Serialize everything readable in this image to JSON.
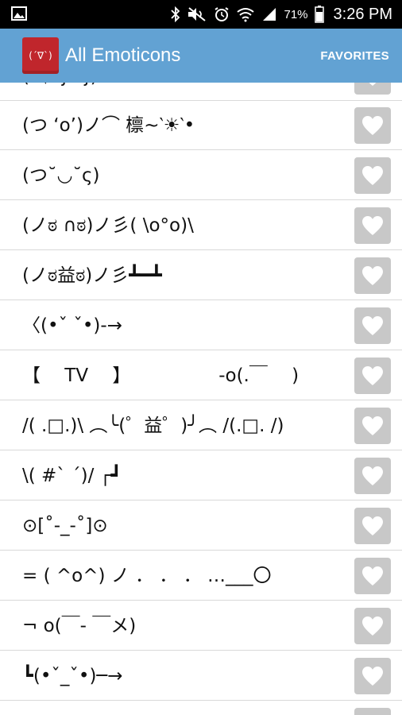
{
  "status_bar": {
    "battery_percent": "71%",
    "time": "3:26 PM"
  },
  "action_bar": {
    "app_icon_text": "(´∇`)",
    "title": "All Emoticons",
    "favorites_label": "FAVORITES"
  },
  "emoticons": [
    "(´▽`ʃ♡ʃ)",
    "(つ ‘o’)ノ⌒ 檩~‵☀‵•",
    "(つ˘◡˘ς)",
    "(ノಠ ∩ಠ)ノ彡( \\o°o)\\",
    "(ノಠ益ಠ)ノ彡┻━┻",
    "〈(•ˇ ˇ•)-→",
    "【 　TV　 】　　　　　 -o(.￣　 )",
    "/( .□.)\\ ︵╰(゜益゜)╯︵ /(.□. /)",
    "\\( #` ´)/ ┌┛",
    "⊙[˚-_-˚]⊙",
    "= ( ^o^) ノ ． ． ． …___〇",
    "¬ o(￣- ￣メ)",
    "┗(•ˇ_ˇ•)─→"
  ]
}
